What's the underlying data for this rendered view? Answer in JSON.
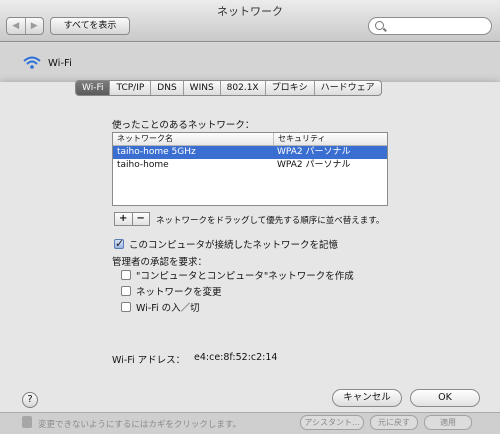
{
  "window": {
    "title": "ネットワーク",
    "show_all": "すべてを表示"
  },
  "header": {
    "service": "Wi-Fi"
  },
  "tabs": [
    "Wi-Fi",
    "TCP/IP",
    "DNS",
    "WINS",
    "802.1X",
    "プロキシ",
    "ハードウェア"
  ],
  "networks": {
    "section_label": "使ったことのあるネットワーク：",
    "columns": [
      "ネットワーク名",
      "セキュリティ"
    ],
    "rows": [
      {
        "name": "taiho-home 5GHz",
        "security": "WPA2 パーソナル",
        "selected": true
      },
      {
        "name": "taiho-home",
        "security": "WPA2 パーソナル",
        "selected": false
      }
    ],
    "add_label": "+",
    "remove_label": "−",
    "hint": "ネットワークをドラッグして優先する順序に並べ替えます。"
  },
  "remember": {
    "label": "このコンピュータが接続したネットワークを記憶",
    "checked": true
  },
  "admin": {
    "label": "管理者の承認を要求：",
    "options": [
      {
        "label": "\"コンピュータとコンピュータ\"ネットワークを作成",
        "checked": false
      },
      {
        "label": "ネットワークを変更",
        "checked": false
      },
      {
        "label": "Wi-Fi の入／切",
        "checked": false
      }
    ]
  },
  "address": {
    "label": "Wi-Fi アドレス：",
    "value": "e4:ce:8f:52:c2:14"
  },
  "buttons": {
    "help": "?",
    "cancel": "キャンセル",
    "ok": "OK"
  },
  "bottom": {
    "faint_text": "変更できないようにするにはカギをクリックします。",
    "assistant": "アシスタント...",
    "revert": "元に戻す",
    "apply": "適用"
  }
}
